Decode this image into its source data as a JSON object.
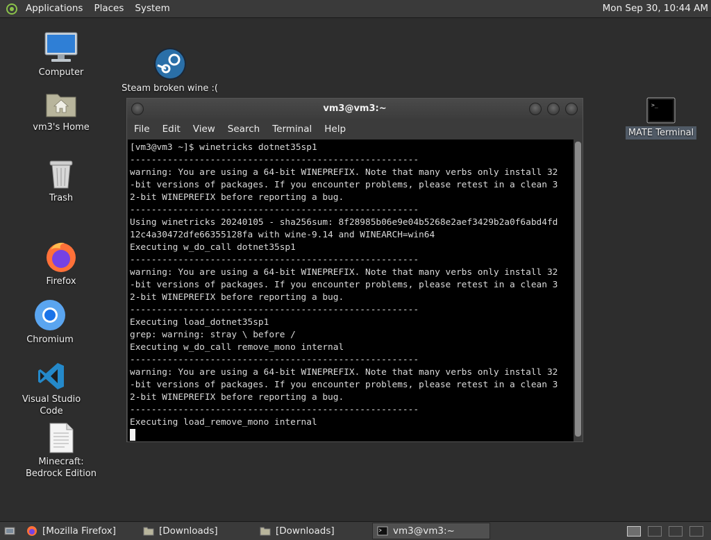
{
  "top_panel": {
    "menus": [
      "Applications",
      "Places",
      "System"
    ],
    "clock": "Mon Sep 30, 10:44 AM"
  },
  "desktop_icons": {
    "computer": "Computer",
    "home": "vm3's Home",
    "trash": "Trash",
    "firefox": "Firefox",
    "chromium": "Chromium",
    "vscode": "Visual Studio Code",
    "minecraft": "Minecraft: Bedrock Edition",
    "steam": "Steam broken wine :(",
    "mate_terminal": "MATE Terminal"
  },
  "terminal": {
    "title": "vm3@vm3:~",
    "menu": [
      "File",
      "Edit",
      "View",
      "Search",
      "Terminal",
      "Help"
    ],
    "lines": [
      "[vm3@vm3 ~]$ winetricks dotnet35sp1",
      "------------------------------------------------------",
      "warning: You are using a 64-bit WINEPREFIX. Note that many verbs only install 32",
      "-bit versions of packages. If you encounter problems, please retest in a clean 3",
      "2-bit WINEPREFIX before reporting a bug.",
      "------------------------------------------------------",
      "Using winetricks 20240105 - sha256sum: 8f28985b06e9e04b5268e2aef3429b2a0f6abd4fd",
      "12c4a30472dfe66355128fa with wine-9.14 and WINEARCH=win64",
      "Executing w_do_call dotnet35sp1",
      "------------------------------------------------------",
      "warning: You are using a 64-bit WINEPREFIX. Note that many verbs only install 32",
      "-bit versions of packages. If you encounter problems, please retest in a clean 3",
      "2-bit WINEPREFIX before reporting a bug.",
      "------------------------------------------------------",
      "Executing load_dotnet35sp1",
      "grep: warning: stray \\ before /",
      "Executing w_do_call remove_mono internal",
      "------------------------------------------------------",
      "warning: You are using a 64-bit WINEPREFIX. Note that many verbs only install 32",
      "-bit versions of packages. If you encounter problems, please retest in a clean 3",
      "2-bit WINEPREFIX before reporting a bug.",
      "------------------------------------------------------",
      "Executing load_remove_mono internal"
    ]
  },
  "taskbar": {
    "items": [
      "[Mozilla Firefox]",
      "[Downloads]",
      "[Downloads]",
      "vm3@vm3:~"
    ]
  },
  "colors": {
    "panel": "#3a3a3a",
    "desktop": "#2d2d2d",
    "terminal_bg": "#000000",
    "terminal_fg": "#dadada"
  }
}
